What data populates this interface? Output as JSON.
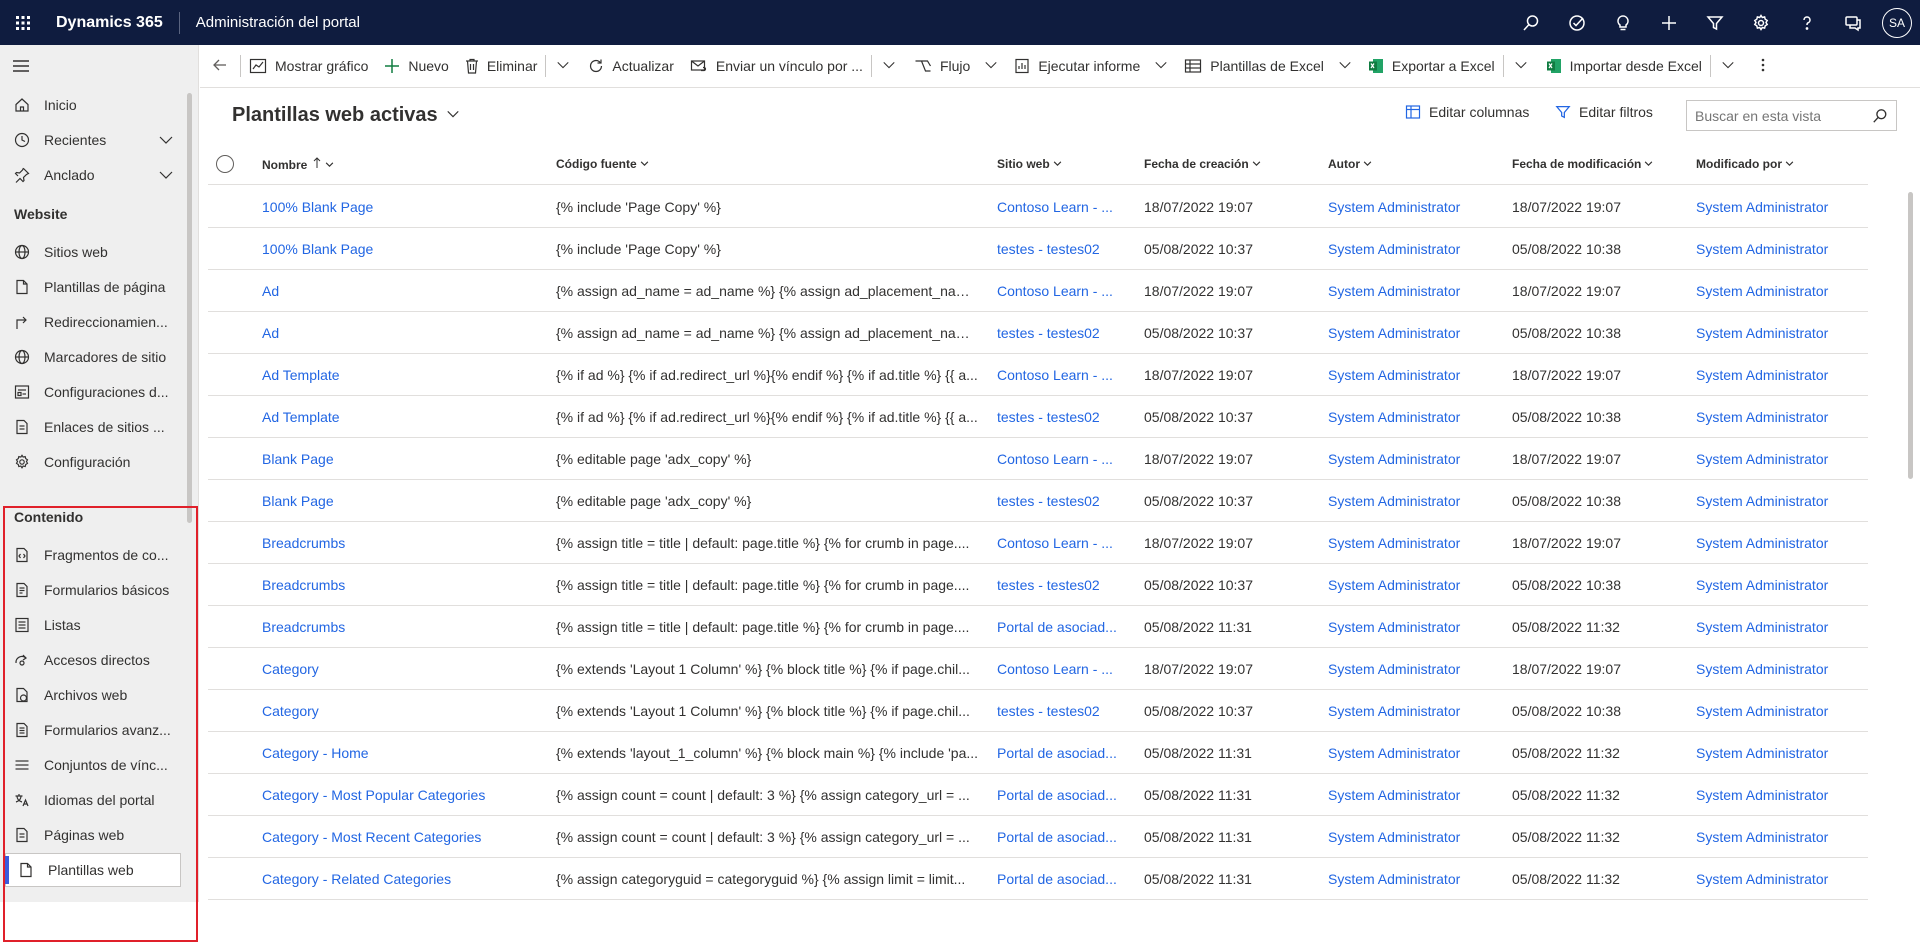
{
  "topbar": {
    "brand": "Dynamics 365",
    "app_title": "Administración del portal",
    "avatar": "SA",
    "icons": [
      "search-icon",
      "task-icon",
      "lightbulb-icon",
      "plus-icon",
      "filter-icon",
      "gear-icon",
      "help-icon",
      "chat-icon"
    ]
  },
  "sidebar": {
    "top_items": [
      {
        "label": "Inicio",
        "icon": "home-icon"
      },
      {
        "label": "Recientes",
        "icon": "clock-icon"
      },
      {
        "label": "Anclado",
        "icon": "pin-icon"
      }
    ],
    "website_header": "Website",
    "website_items": [
      {
        "label": "Sitios web",
        "icon": "globe-icon"
      },
      {
        "label": "Plantillas de página",
        "icon": "page-icon"
      },
      {
        "label": "Redireccionamien...",
        "icon": "redirect-icon"
      },
      {
        "label": "Marcadores de sitio",
        "icon": "globe-icon"
      },
      {
        "label": "Configuraciones d...",
        "icon": "settings-list-icon"
      },
      {
        "label": "Enlaces de sitios ...",
        "icon": "link-doc-icon"
      },
      {
        "label": "Configuración",
        "icon": "gear-icon"
      }
    ],
    "content_header": "Contenido",
    "content_items": [
      {
        "label": "Fragmentos de co...",
        "icon": "snippet-icon"
      },
      {
        "label": "Formularios básicos",
        "icon": "form-icon"
      },
      {
        "label": "Listas",
        "icon": "list-icon"
      },
      {
        "label": "Accesos directos",
        "icon": "shortcut-icon"
      },
      {
        "label": "Archivos web",
        "icon": "web-file-icon"
      },
      {
        "label": "Formularios avanz...",
        "icon": "form-icon"
      },
      {
        "label": "Conjuntos de vínc...",
        "icon": "lines-icon"
      },
      {
        "label": "Idiomas del portal",
        "icon": "language-icon"
      },
      {
        "label": "Páginas web",
        "icon": "web-page-icon"
      },
      {
        "label": "Plantillas web",
        "icon": "page-icon"
      }
    ]
  },
  "cmdbar": {
    "back": "back-arrow-icon",
    "show_chart": "Mostrar gráfico",
    "new": "Nuevo",
    "delete": "Eliminar",
    "refresh": "Actualizar",
    "email_link": "Enviar un vínculo por ...",
    "flow": "Flujo",
    "run_report": "Ejecutar informe",
    "excel_templates": "Plantillas de Excel",
    "export_excel": "Exportar a Excel",
    "import_excel": "Importar desde Excel"
  },
  "view": {
    "title": "Plantillas web activas",
    "edit_columns": "Editar columnas",
    "edit_filters": "Editar filtros",
    "search_placeholder": "Buscar en esta vista"
  },
  "grid": {
    "columns": [
      "Nombre",
      "Código fuente",
      "Sitio web",
      "Fecha de creación",
      "Autor",
      "Fecha de modificación",
      "Modificado por"
    ],
    "rows": [
      [
        "100% Blank Page",
        "{% include 'Page Copy' %}",
        "Contoso Learn - ...",
        "18/07/2022 19:07",
        "System Administrator",
        "18/07/2022 19:07",
        "System Administrator"
      ],
      [
        "100% Blank Page",
        "{% include 'Page Copy' %}",
        "testes - testes02",
        "05/08/2022 10:37",
        "System Administrator",
        "05/08/2022 10:38",
        "System Administrator"
      ],
      [
        "Ad",
        "{% assign ad_name = ad_name %} {% assign ad_placement_name...",
        "Contoso Learn - ...",
        "18/07/2022 19:07",
        "System Administrator",
        "18/07/2022 19:07",
        "System Administrator"
      ],
      [
        "Ad",
        "{% assign ad_name = ad_name %} {% assign ad_placement_name...",
        "testes - testes02",
        "05/08/2022 10:37",
        "System Administrator",
        "05/08/2022 10:38",
        "System Administrator"
      ],
      [
        "Ad Template",
        "{% if ad %} {% if ad.redirect_url %}{% endif %} {% if ad.title %} {{ a...",
        "Contoso Learn - ...",
        "18/07/2022 19:07",
        "System Administrator",
        "18/07/2022 19:07",
        "System Administrator"
      ],
      [
        "Ad Template",
        "{% if ad %} {% if ad.redirect_url %}{% endif %} {% if ad.title %} {{ a...",
        "testes - testes02",
        "05/08/2022 10:37",
        "System Administrator",
        "05/08/2022 10:38",
        "System Administrator"
      ],
      [
        "Blank Page",
        "{% editable page 'adx_copy' %}",
        "Contoso Learn - ...",
        "18/07/2022 19:07",
        "System Administrator",
        "18/07/2022 19:07",
        "System Administrator"
      ],
      [
        "Blank Page",
        "{% editable page 'adx_copy' %}",
        "testes - testes02",
        "05/08/2022 10:37",
        "System Administrator",
        "05/08/2022 10:38",
        "System Administrator"
      ],
      [
        "Breadcrumbs",
        "{% assign title = title | default: page.title %} {% for crumb in page....",
        "Contoso Learn - ...",
        "18/07/2022 19:07",
        "System Administrator",
        "18/07/2022 19:07",
        "System Administrator"
      ],
      [
        "Breadcrumbs",
        "{% assign title = title | default: page.title %} {% for crumb in page....",
        "testes - testes02",
        "05/08/2022 10:37",
        "System Administrator",
        "05/08/2022 10:38",
        "System Administrator"
      ],
      [
        "Breadcrumbs",
        "{% assign title = title | default: page.title %} {% for crumb in page....",
        "Portal de asociad...",
        "05/08/2022 11:31",
        "System Administrator",
        "05/08/2022 11:32",
        "System Administrator"
      ],
      [
        "Category",
        "{% extends 'Layout 1 Column' %} {% block title %} {% if page.chil...",
        "Contoso Learn - ...",
        "18/07/2022 19:07",
        "System Administrator",
        "18/07/2022 19:07",
        "System Administrator"
      ],
      [
        "Category",
        "{% extends 'Layout 1 Column' %} {% block title %} {% if page.chil...",
        "testes - testes02",
        "05/08/2022 10:37",
        "System Administrator",
        "05/08/2022 10:38",
        "System Administrator"
      ],
      [
        "Category - Home",
        "{% extends 'layout_1_column' %} {% block main %} {% include 'pa...",
        "Portal de asociad...",
        "05/08/2022 11:31",
        "System Administrator",
        "05/08/2022 11:32",
        "System Administrator"
      ],
      [
        "Category - Most Popular Categories",
        "{% assign count = count | default: 3 %} {% assign category_url = ...",
        "Portal de asociad...",
        "05/08/2022 11:31",
        "System Administrator",
        "05/08/2022 11:32",
        "System Administrator"
      ],
      [
        "Category - Most Recent Categories",
        "{% assign count = count | default: 3 %} {% assign category_url = ...",
        "Portal de asociad...",
        "05/08/2022 11:31",
        "System Administrator",
        "05/08/2022 11:32",
        "System Administrator"
      ],
      [
        "Category - Related Categories",
        "{% assign categoryguid = categoryguid %} {% assign limit = limit...",
        "Portal de asociad...",
        "05/08/2022 11:31",
        "System Administrator",
        "05/08/2022 11:32",
        "System Administrator"
      ]
    ]
  },
  "colors": {
    "topbar": "#0f1c3f",
    "link": "#2266e3",
    "highlight_border": "#e0202a",
    "selected_indicator": "#3b5bdb",
    "excel_green": "#107c41"
  }
}
